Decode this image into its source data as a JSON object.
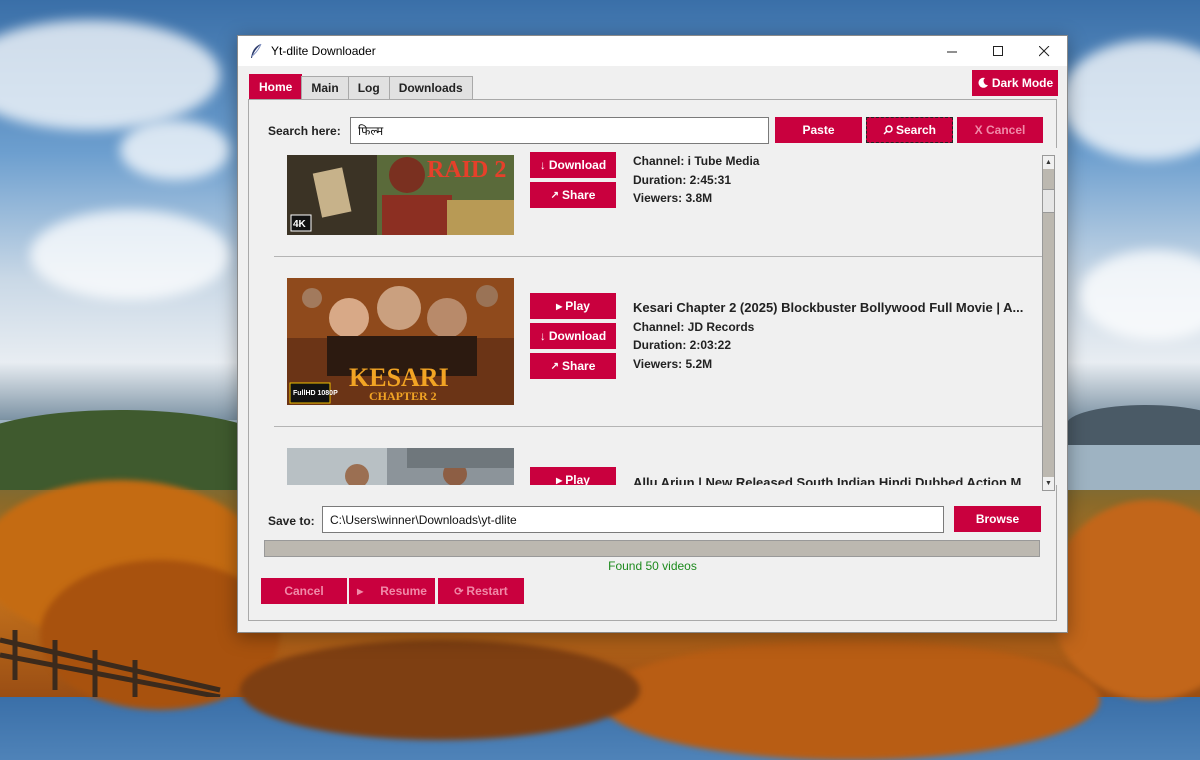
{
  "window": {
    "title": "Yt-dlite Downloader"
  },
  "tabs": [
    {
      "label": "Home",
      "active": true
    },
    {
      "label": "Main",
      "active": false
    },
    {
      "label": "Log",
      "active": false
    },
    {
      "label": "Downloads",
      "active": false
    }
  ],
  "dark_mode_label": "Dark Mode",
  "search": {
    "label": "Search here:",
    "value": "फिल्म",
    "paste": "Paste",
    "search": "Search",
    "cancel": "X Cancel"
  },
  "results": [
    {
      "thumb_text": "RAID 2",
      "badge": "4K",
      "title": "",
      "channel": "Channel: i Tube Media",
      "duration": "Duration: 2:45:31",
      "viewers": "Viewers: 3.8M",
      "download": "Download",
      "share": "Share"
    },
    {
      "thumb_text": "KESARI",
      "thumb_sub": "CHAPTER 2",
      "badge": "FullHD 1080P",
      "title": "Kesari Chapter 2 (2025) Blockbuster Bollywood Full Movie | A...",
      "channel": "Channel: JD Records",
      "duration": "Duration: 2:03:22",
      "viewers": "Viewers: 5.2M",
      "play": "Play",
      "download": "Download",
      "share": "Share"
    },
    {
      "title": "Allu Arjun | New Released South Indian Hindi Dubbed Action M...",
      "play": "Play"
    }
  ],
  "save": {
    "label": "Save to:",
    "path": "C:\\Users\\winner\\Downloads\\yt-dlite",
    "browse": "Browse"
  },
  "progress": 0,
  "status": "Found 50 videos",
  "bottom": {
    "cancel": "Cancel",
    "resume": "Resume",
    "restart": "Restart"
  },
  "colors": {
    "accent": "#c9003e",
    "status": "#1d8a1d"
  }
}
